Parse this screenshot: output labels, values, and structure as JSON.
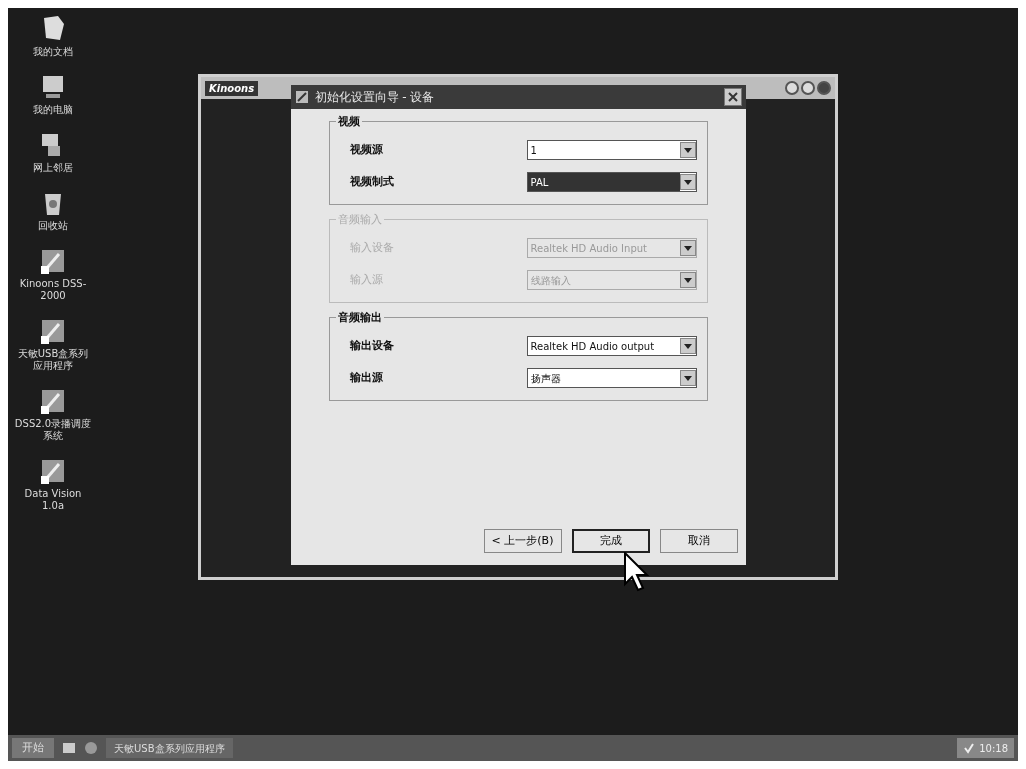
{
  "desktop_icons": [
    {
      "kind": "document",
      "label": "我的文档"
    },
    {
      "kind": "computer",
      "label": "我的电脑"
    },
    {
      "kind": "network",
      "label": "网上邻居"
    },
    {
      "kind": "recycle",
      "label": "回收站"
    },
    {
      "kind": "app",
      "label": "Kinoons DSS-2000"
    },
    {
      "kind": "app",
      "label": "天敏USB盒系列应用程序"
    },
    {
      "kind": "app",
      "label": "DSS2.0录播调度系统"
    },
    {
      "kind": "app",
      "label": "Data Vision 1.0a"
    }
  ],
  "app_window": {
    "logo": "Kinoons"
  },
  "dialog": {
    "title": "初始化设置向导 - 设备",
    "groups": [
      {
        "title": "视频",
        "disabled": false,
        "fields": [
          {
            "label": "视频源",
            "value": "1",
            "selected": false
          },
          {
            "label": "视频制式",
            "value": "PAL",
            "selected": true
          }
        ]
      },
      {
        "title": "音频输入",
        "disabled": true,
        "fields": [
          {
            "label": "输入设备",
            "value": "Realtek HD Audio Input",
            "selected": false
          },
          {
            "label": "输入源",
            "value": "线路输入",
            "selected": false
          }
        ]
      },
      {
        "title": "音频输出",
        "disabled": false,
        "fields": [
          {
            "label": "输出设备",
            "value": "Realtek HD Audio output",
            "selected": false
          },
          {
            "label": "输出源",
            "value": "扬声器",
            "selected": false
          }
        ]
      }
    ],
    "buttons": [
      {
        "label": "< 上一步(B)",
        "focused": false
      },
      {
        "label": "完成",
        "focused": true
      },
      {
        "label": "取消",
        "focused": false
      }
    ]
  },
  "taskbar": {
    "start": "开始",
    "tasks": [
      "天敏USB盒系列应用程序"
    ],
    "clock": "10:18"
  }
}
